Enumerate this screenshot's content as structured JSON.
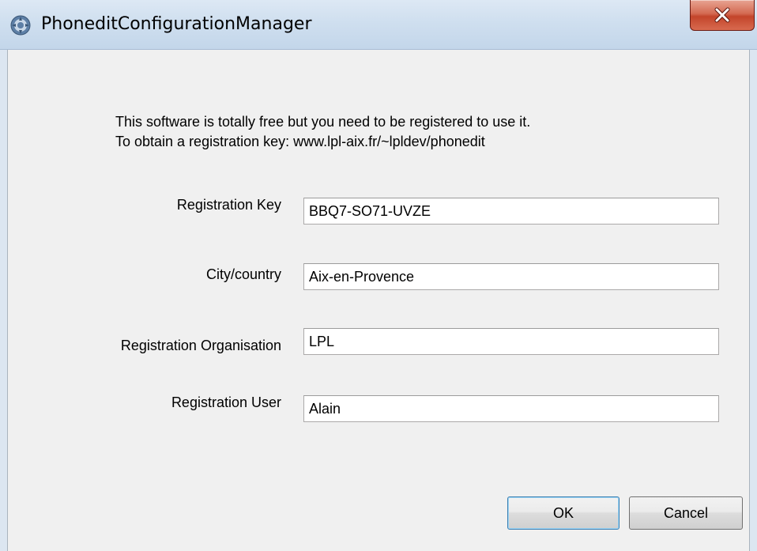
{
  "window": {
    "title": "PhoneditConfigurationManager"
  },
  "info": {
    "line1": "This software is totally free but you need to be registered to use it.",
    "line2": "To obtain a registration key: www.lpl-aix.fr/~lpldev/phonedit"
  },
  "fields": {
    "registration_key": {
      "label": "Registration Key",
      "value": "BBQ7-SO71-UVZE"
    },
    "city_country": {
      "label": "City/country",
      "value": "Aix-en-Provence"
    },
    "organisation": {
      "label": "Registration Organisation",
      "value": "LPL"
    },
    "user": {
      "label": "Registration User",
      "value": "Alain"
    }
  },
  "buttons": {
    "ok_label": "OK",
    "cancel_label": "Cancel"
  },
  "icons": {
    "app": "app-gear-icon",
    "close": "close-icon"
  },
  "colors": {
    "close_button": "#c3452b",
    "titlebar": "#cfdfef",
    "client_background": "#f0f0f0"
  }
}
